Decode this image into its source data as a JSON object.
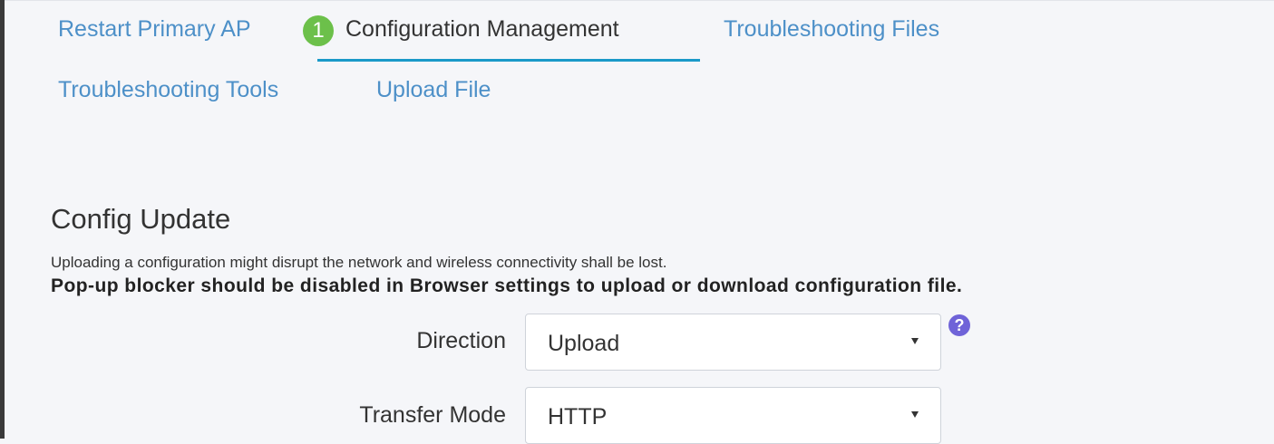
{
  "tabs": {
    "restart_primary_ap": "Restart Primary AP",
    "step_badge": "1",
    "configuration_management": "Configuration Management",
    "troubleshooting_files": "Troubleshooting Files",
    "troubleshooting_tools": "Troubleshooting Tools",
    "upload_file": "Upload File",
    "active": "configuration_management"
  },
  "config_update": {
    "title": "Config Update",
    "note": "Uploading a configuration might disrupt the network and wireless connectivity shall be lost.",
    "warning": "Pop-up blocker should be disabled in Browser settings to upload or download configuration file.",
    "direction_label": "Direction",
    "direction_value": "Upload",
    "transfer_mode_label": "Transfer Mode",
    "transfer_mode_value": "HTTP",
    "help_glyph": "?"
  },
  "colors": {
    "tab_link": "#4d90c8",
    "tab_active": "#333333",
    "tab_underline": "#1a99c8",
    "step_badge": "#6cc04a",
    "help_icon": "#6f63d8",
    "background": "#f5f6f9"
  },
  "icons": {
    "caret": "caret-down-icon",
    "help": "question-circle-icon",
    "step": "step-number-badge-icon"
  }
}
